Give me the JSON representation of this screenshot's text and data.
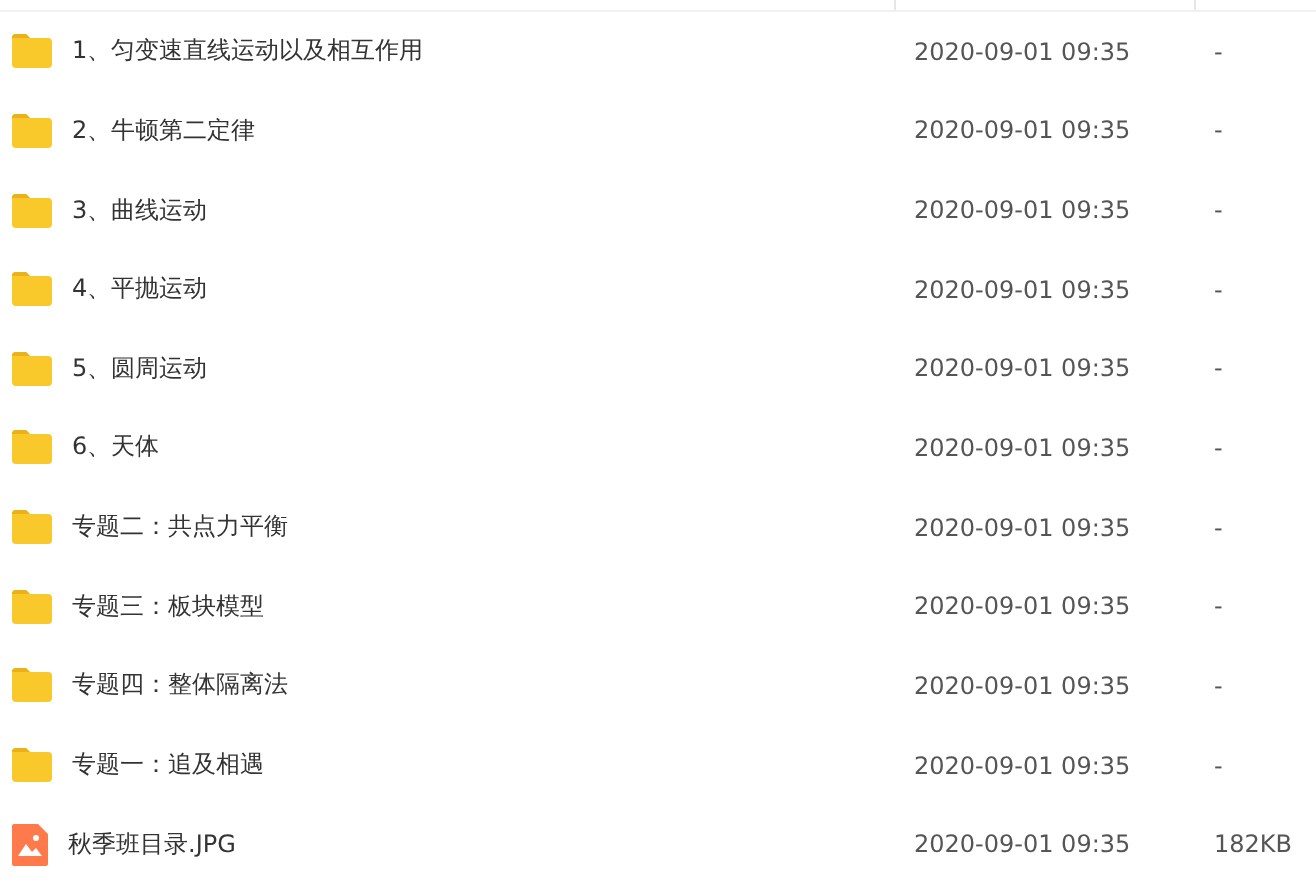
{
  "files": [
    {
      "kind": "folder",
      "name": "1、匀变速直线运动以及相互作用",
      "modified": "2020-09-01 09:35",
      "size": "-"
    },
    {
      "kind": "folder",
      "name": "2、牛顿第二定律",
      "modified": "2020-09-01 09:35",
      "size": "-"
    },
    {
      "kind": "folder",
      "name": "3、曲线运动",
      "modified": "2020-09-01 09:35",
      "size": "-"
    },
    {
      "kind": "folder",
      "name": "4、平抛运动",
      "modified": "2020-09-01 09:35",
      "size": "-"
    },
    {
      "kind": "folder",
      "name": "5、圆周运动",
      "modified": "2020-09-01 09:35",
      "size": "-"
    },
    {
      "kind": "folder",
      "name": "6、天体",
      "modified": "2020-09-01 09:35",
      "size": "-"
    },
    {
      "kind": "folder",
      "name": "专题二：共点力平衡",
      "modified": "2020-09-01 09:35",
      "size": "-"
    },
    {
      "kind": "folder",
      "name": "专题三：板块模型",
      "modified": "2020-09-01 09:35",
      "size": "-"
    },
    {
      "kind": "folder",
      "name": "专题四：整体隔离法",
      "modified": "2020-09-01 09:35",
      "size": "-"
    },
    {
      "kind": "folder",
      "name": "专题一：追及相遇",
      "modified": "2020-09-01 09:35",
      "size": "-"
    },
    {
      "kind": "image",
      "name": "秋季班目录.JPG",
      "modified": "2020-09-01 09:35",
      "size": "182KB"
    }
  ]
}
